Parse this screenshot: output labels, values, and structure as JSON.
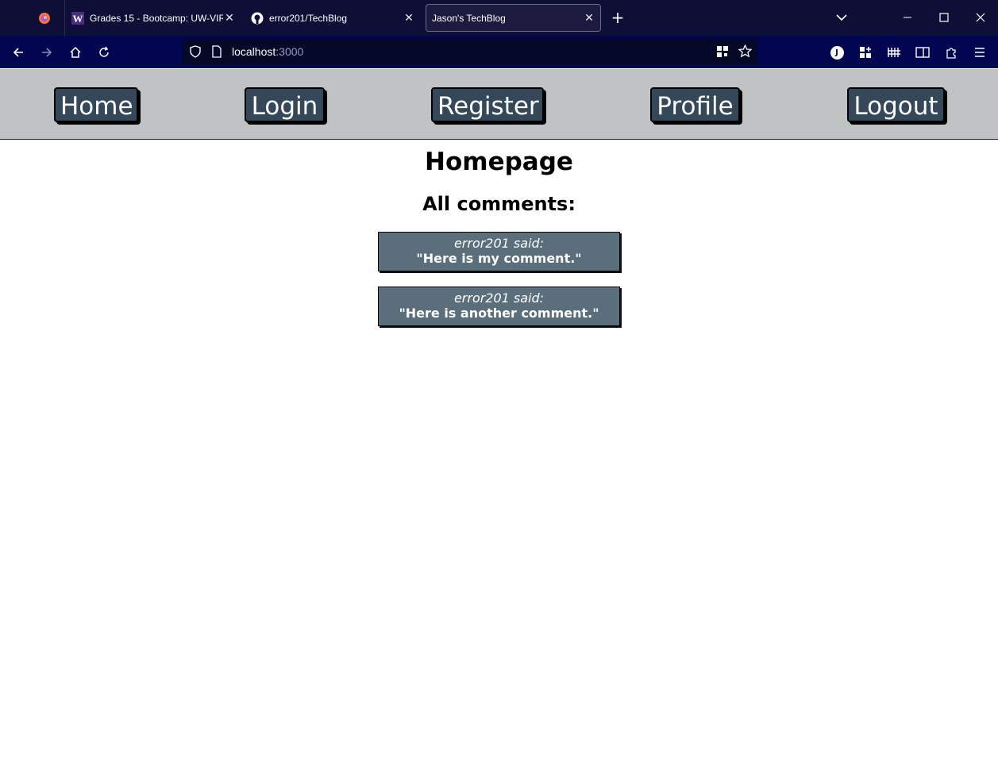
{
  "browser": {
    "tabs": [
      {
        "label": "",
        "icon": "firefox-icon"
      },
      {
        "label": "Grades 15 - Bootcamp: UW-VIRT",
        "icon": "w-logo-icon"
      },
      {
        "label": "error201/TechBlog",
        "icon": "github-icon"
      },
      {
        "label": "Jason's TechBlog",
        "icon": "",
        "active": true
      }
    ],
    "url": {
      "host": "localhost",
      "port": ":3000"
    },
    "account_initial": "J"
  },
  "nav": {
    "home": "Home",
    "login": "Login",
    "register": "Register",
    "profile": "Profile",
    "logout": "Logout"
  },
  "main": {
    "title": "Homepage",
    "comments_heading": "All comments:",
    "comments": [
      {
        "author_line": "error201 said:",
        "text": "\"Here is my comment.\""
      },
      {
        "author_line": "error201 said:",
        "text": "\"Here is another comment.\""
      }
    ]
  },
  "colors": {
    "titlebar": "#0e0e36",
    "toolbar": "#02054f",
    "navbar": "#c0c3c3",
    "nav_button": "#34485a",
    "comment_box": "#5a6e7b"
  }
}
